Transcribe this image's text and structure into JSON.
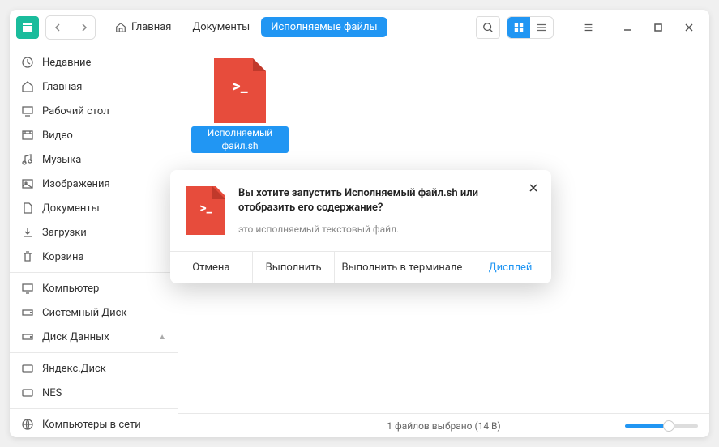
{
  "breadcrumb": [
    {
      "label": "Главная",
      "home": true
    },
    {
      "label": "Документы"
    },
    {
      "label": "Исполняемые файлы",
      "active": true
    }
  ],
  "sidebar": {
    "items": [
      {
        "label": "Недавние",
        "icon": "clock"
      },
      {
        "label": "Главная",
        "icon": "home"
      },
      {
        "label": "Рабочий стол",
        "icon": "desktop"
      },
      {
        "label": "Видео",
        "icon": "video"
      },
      {
        "label": "Музыка",
        "icon": "music"
      },
      {
        "label": "Изображения",
        "icon": "image"
      },
      {
        "label": "Документы",
        "icon": "document"
      },
      {
        "label": "Загрузки",
        "icon": "download"
      },
      {
        "label": "Корзина",
        "icon": "trash"
      }
    ],
    "devices": [
      {
        "label": "Компьютер",
        "icon": "computer"
      },
      {
        "label": "Системный Диск",
        "icon": "disk"
      },
      {
        "label": "Диск Данных",
        "icon": "disk",
        "eject": true
      }
    ],
    "network": [
      {
        "label": "Яндекс.Диск",
        "icon": "cloud"
      },
      {
        "label": "NES",
        "icon": "cloud"
      }
    ],
    "shared": [
      {
        "label": "Компьютеры в сети",
        "icon": "network"
      }
    ]
  },
  "file": {
    "name": "Исполняемый файл.sh"
  },
  "statusbar": "1 файлов выбрано (14 B)",
  "dialog": {
    "title": "Вы хотите запустить Исполняемый файл.sh или отобразить его содержание?",
    "subtitle": "это исполняемый текстовый файл.",
    "actions": {
      "cancel": "Отмена",
      "run": "Выполнить",
      "run_terminal": "Выполнить в терминале",
      "display": "Дисплей"
    }
  }
}
